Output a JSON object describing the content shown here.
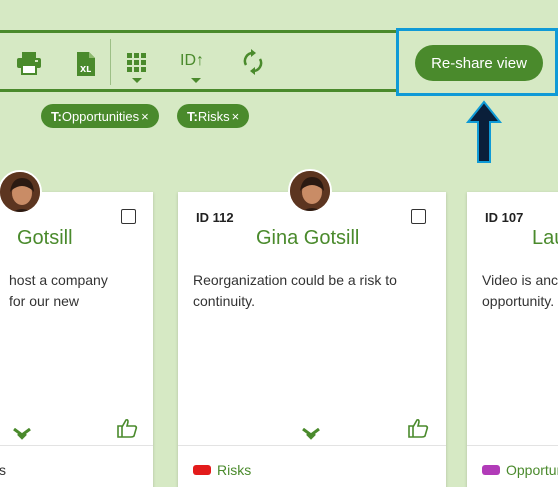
{
  "toolbar": {
    "icons": [
      "printer-icon",
      "excel-export-icon",
      "grid-view-icon",
      "sort-by-id-icon",
      "refresh-icon"
    ],
    "sort_label": "ID↑",
    "reshare_label": "Re-share view"
  },
  "filters": [
    {
      "prefix": "T:",
      "label": "Opportunities",
      "remove": "×"
    },
    {
      "prefix": "T:",
      "label": "Risks",
      "remove": "×"
    }
  ],
  "cards": [
    {
      "id_label": "",
      "name": "Gotsill",
      "description_lines": [
        "host a company",
        "for our new"
      ],
      "tag_label": "s",
      "tag_color": ""
    },
    {
      "id_label": "ID 112",
      "name": "Gina Gotsill",
      "description_lines": [
        "Reorganization could be a risk to",
        "continuity."
      ],
      "tag_label": "Risks",
      "tag_color": "#e31b1b"
    },
    {
      "id_label": "ID 107",
      "name": "Lau",
      "description_lines": [
        "Video is anc",
        "opportunity."
      ],
      "tag_label": "Opportur",
      "tag_color": "#b13bb8"
    }
  ],
  "colors": {
    "accent": "#4a8a2c",
    "background": "#d6e9c4",
    "highlight": "#0f9ad6",
    "arrow": "#0a1f3a"
  }
}
